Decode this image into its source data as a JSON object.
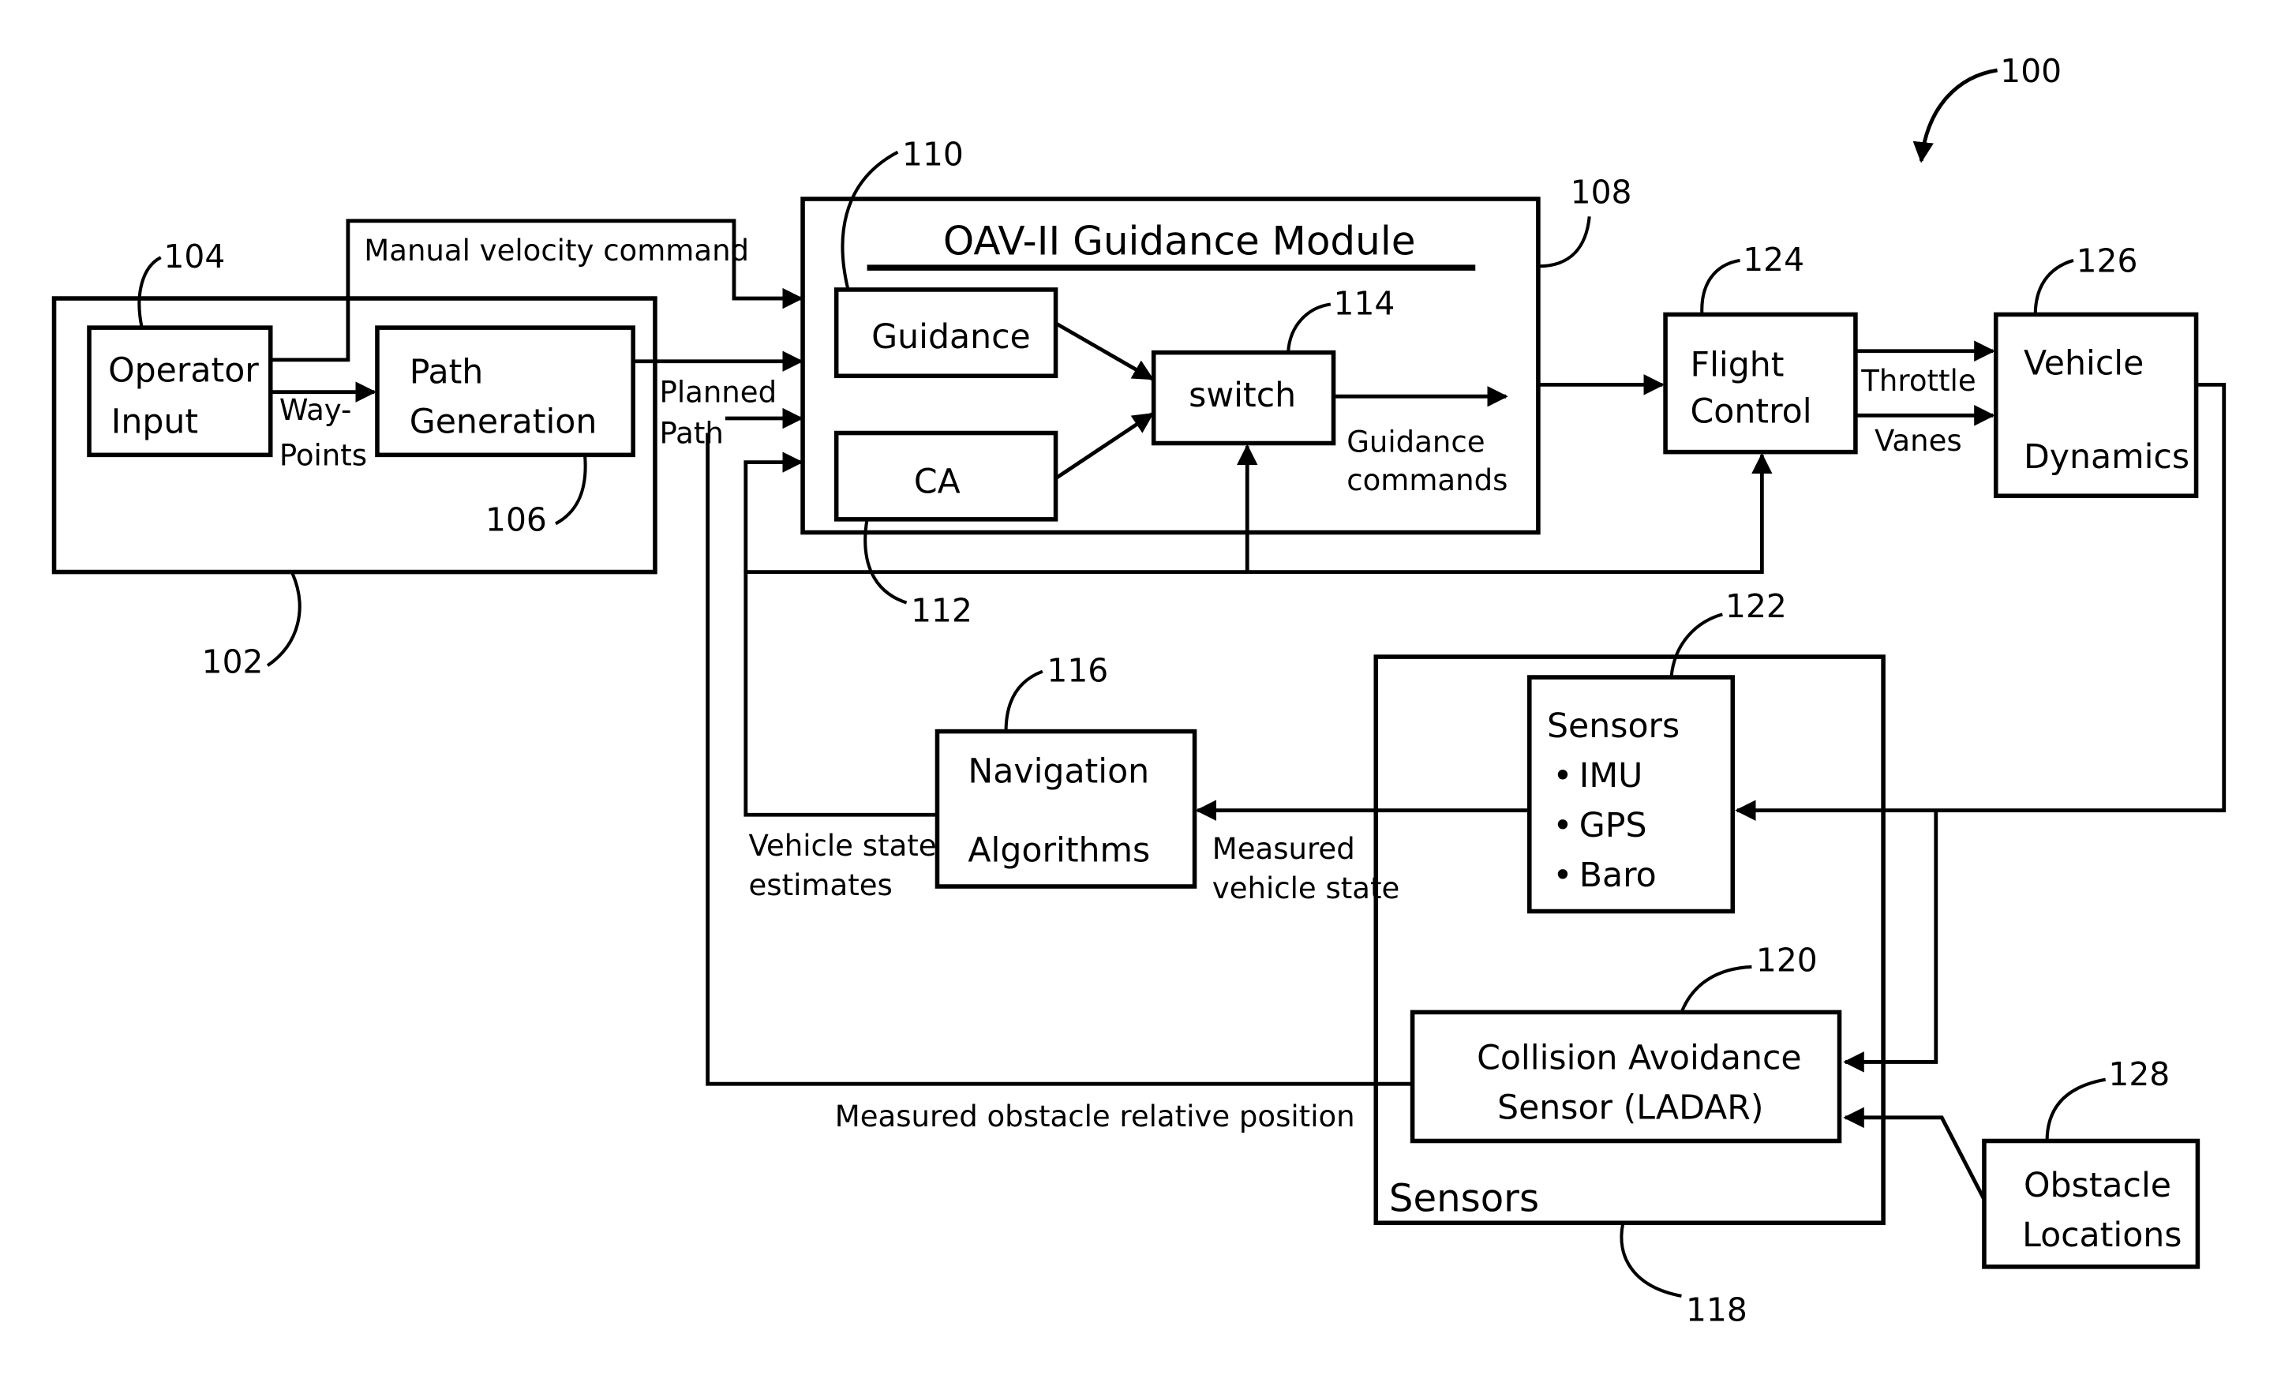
{
  "figure": {
    "ref": "100",
    "blocks": {
      "operator_system": {
        "ref": "102"
      },
      "operator_input": {
        "ref": "104",
        "lines": [
          "Operator",
          "Input"
        ]
      },
      "path_generation": {
        "ref": "106",
        "lines": [
          "Path",
          "Generation"
        ]
      },
      "guidance_module": {
        "ref": "108",
        "title": "OAV-II Guidance Module"
      },
      "guidance": {
        "ref": "110",
        "label": "Guidance"
      },
      "ca": {
        "ref": "112",
        "label": "CA"
      },
      "switch": {
        "ref": "114",
        "label": "switch"
      },
      "navigation": {
        "ref": "116",
        "lines": [
          "Navigation",
          "Algorithms"
        ]
      },
      "sensors_group": {
        "ref": "118",
        "label": "Sensors"
      },
      "ca_sensor": {
        "ref": "120",
        "lines": [
          "Collision Avoidance",
          "Sensor (LADAR)"
        ]
      },
      "sensors": {
        "ref": "122",
        "title": "Sensors",
        "items": [
          "IMU",
          "GPS",
          "Baro"
        ]
      },
      "flight_control": {
        "ref": "124",
        "lines": [
          "Flight",
          "Control"
        ]
      },
      "vehicle_dynamics": {
        "ref": "126",
        "lines": [
          "Vehicle",
          "Dynamics"
        ]
      },
      "obstacle_locations": {
        "ref": "128",
        "lines": [
          "Obstacle",
          "Locations"
        ]
      }
    },
    "signals": {
      "manual_velocity": "Manual velocity command",
      "waypoints": [
        "Way-",
        "Points"
      ],
      "planned_path": [
        "Planned",
        "Path"
      ],
      "guidance_commands": [
        "Guidance",
        "commands"
      ],
      "throttle": "Throttle",
      "vanes": "Vanes",
      "vehicle_state_estimates": [
        "Vehicle state",
        "estimates"
      ],
      "measured_vehicle_state": [
        "Measured",
        "vehicle state"
      ],
      "measured_obstacle": "Measured obstacle relative position"
    }
  }
}
